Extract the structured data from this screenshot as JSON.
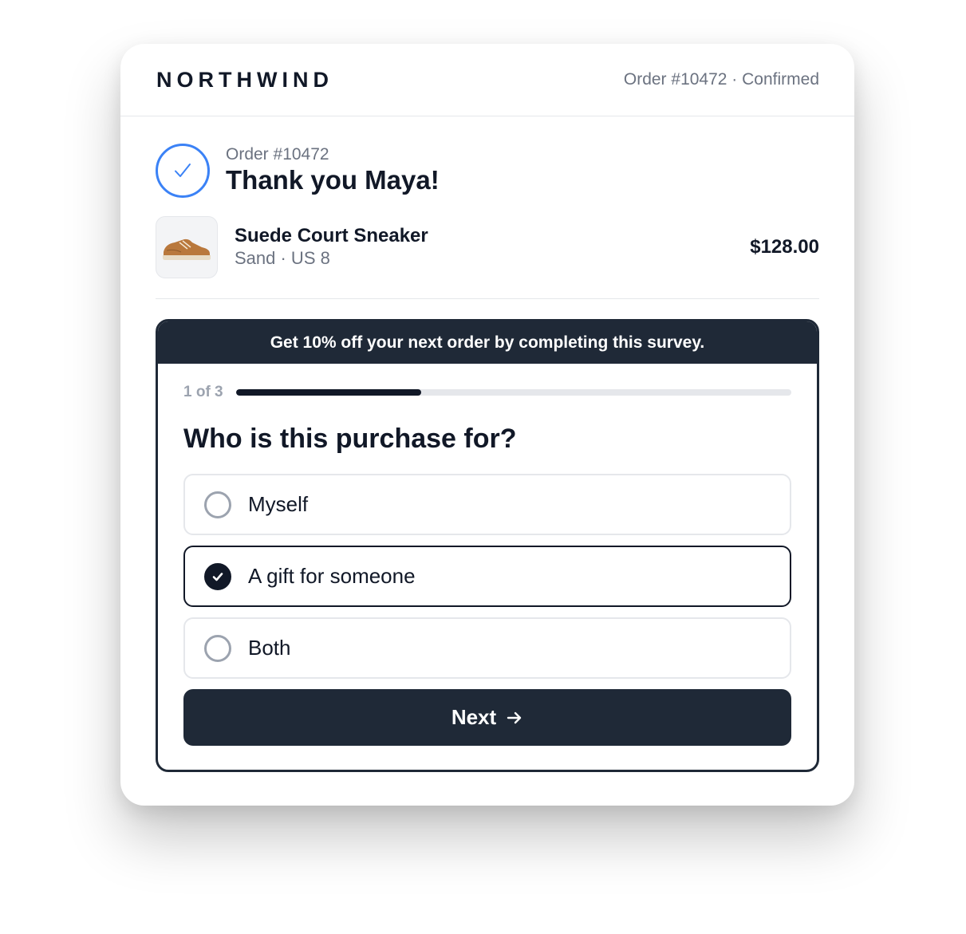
{
  "header": {
    "logo": "NORTHWIND",
    "order_status": "Order #10472 · Confirmed"
  },
  "confirmation": {
    "order_number": "Order #10472",
    "thanks": "Thank you Maya!"
  },
  "product": {
    "name": "Suede Court Sneaker",
    "variant": "Sand · US 8",
    "price": "$128.00"
  },
  "survey": {
    "banner": "Get 10% off your next order by completing this survey.",
    "step": "1 of 3",
    "progress_fraction": 0.333,
    "question": "Who is this purchase for?",
    "options": [
      {
        "label": "Myself",
        "selected": false
      },
      {
        "label": "A gift for someone",
        "selected": true
      },
      {
        "label": "Both",
        "selected": false
      }
    ],
    "next_label": "Next"
  },
  "colors": {
    "accent": "#3b82f6",
    "dark": "#1f2937"
  }
}
